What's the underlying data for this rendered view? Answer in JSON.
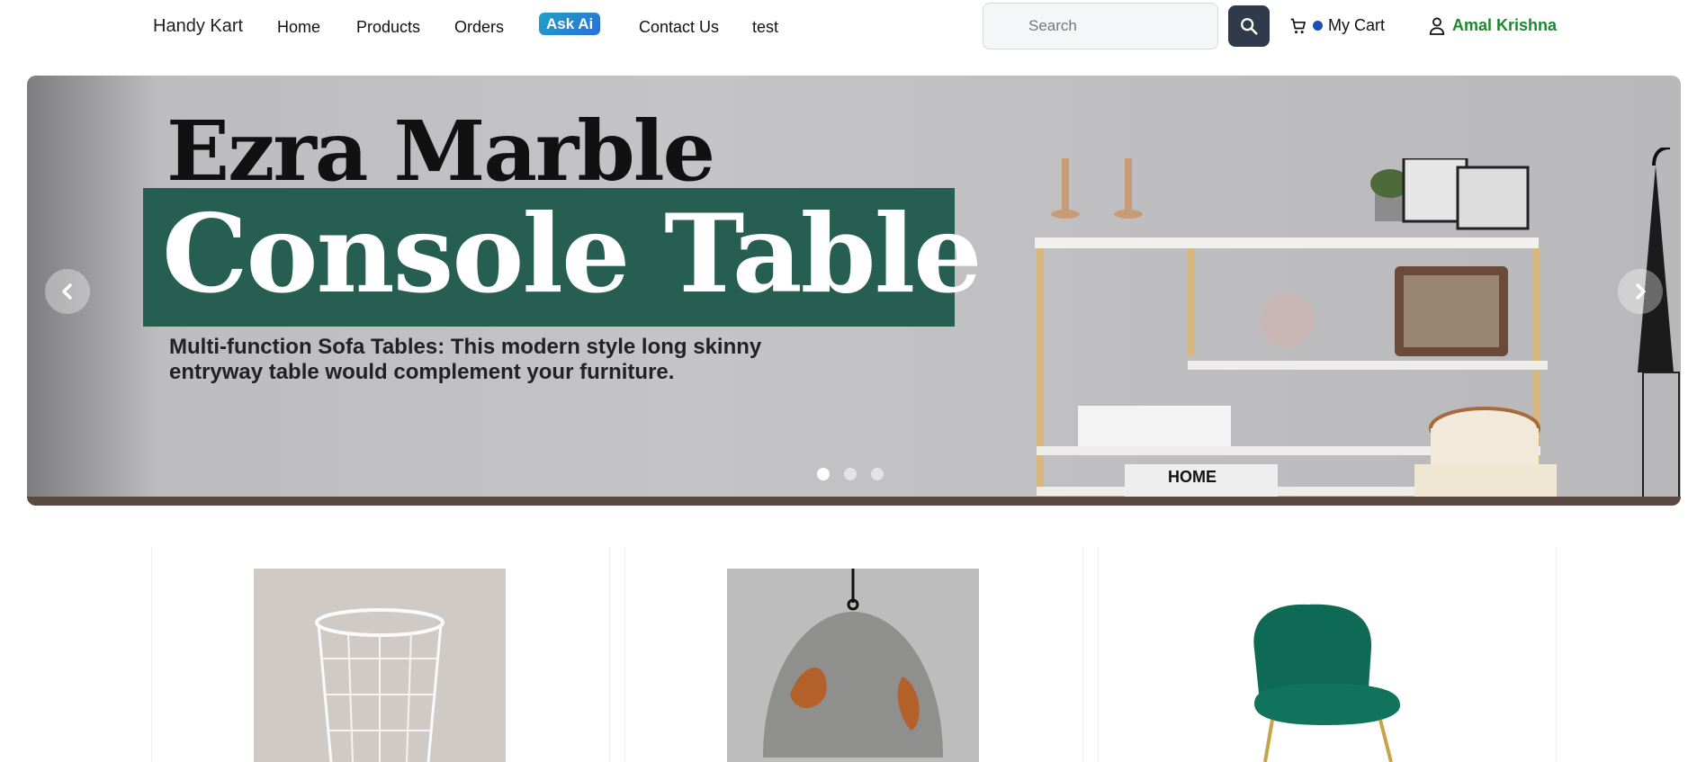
{
  "navbar": {
    "brand": "Handy Kart",
    "links": {
      "home": "Home",
      "products": "Products",
      "orders": "Orders",
      "ask_ai": "Ask Ai",
      "contact": "Contact Us",
      "test": "test"
    },
    "search": {
      "placeholder": "Search"
    },
    "cart_label": "My Cart",
    "user_name": "Amal Krishna"
  },
  "carousel": {
    "title_line1": "Ezra Marble",
    "title_line2": "Console Table",
    "description": "Multi-function Sofa Tables: This modern style long skinny entryway table would complement your furniture.",
    "box_label": "HOME",
    "slides_count": 3,
    "active_slide": 1
  },
  "products": [
    {
      "image": "wire-basket"
    },
    {
      "image": "pendant-lamp"
    },
    {
      "image": "green-velvet-chair"
    }
  ],
  "colors": {
    "band": "#275e52",
    "user": "#1b8a2b",
    "search_button": "#2f3a4a",
    "cart_dot": "#1a4fb8"
  }
}
